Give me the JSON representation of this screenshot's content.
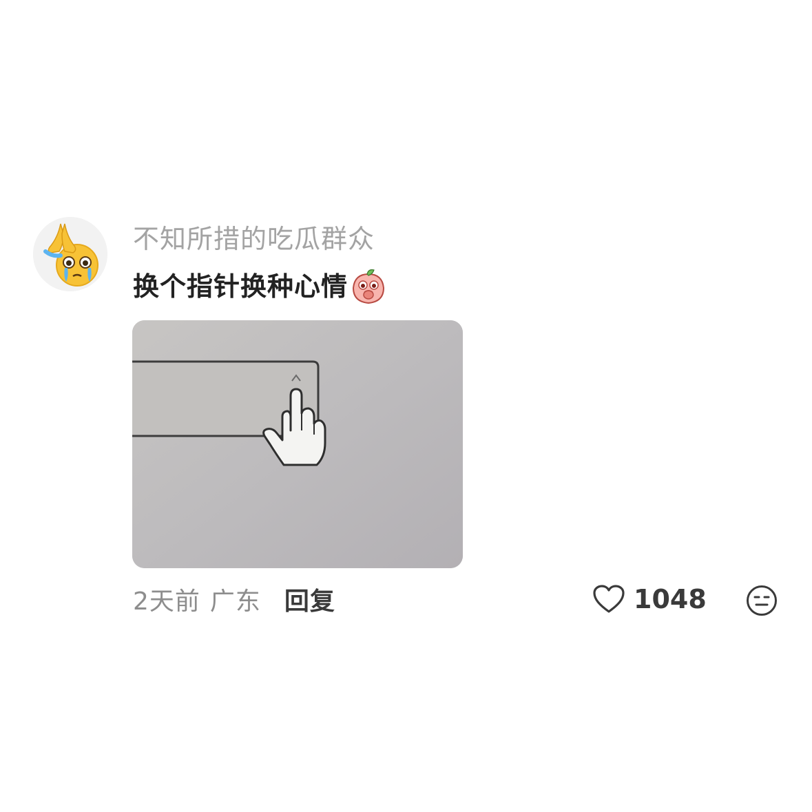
{
  "comment": {
    "avatar_icon": "praying-hands-teary-emoji-icon",
    "username": "不知所措的吃瓜群众",
    "text": "换个指针换种心情",
    "sticker_icon": "blushing-peach-sticker-icon",
    "media_icon": "middle-finger-cursor-image",
    "time": "2天前",
    "location": "广东",
    "reply_label": "回复",
    "like_icon": "heart-outline-icon",
    "like_count": "1048",
    "dislike_icon": "meh-face-icon"
  },
  "colors": {
    "username": "#a3a3a3",
    "text": "#222222",
    "meta": "#8d8d8d",
    "action": "#3a3a3a",
    "media_bg": "#bebcbd"
  }
}
